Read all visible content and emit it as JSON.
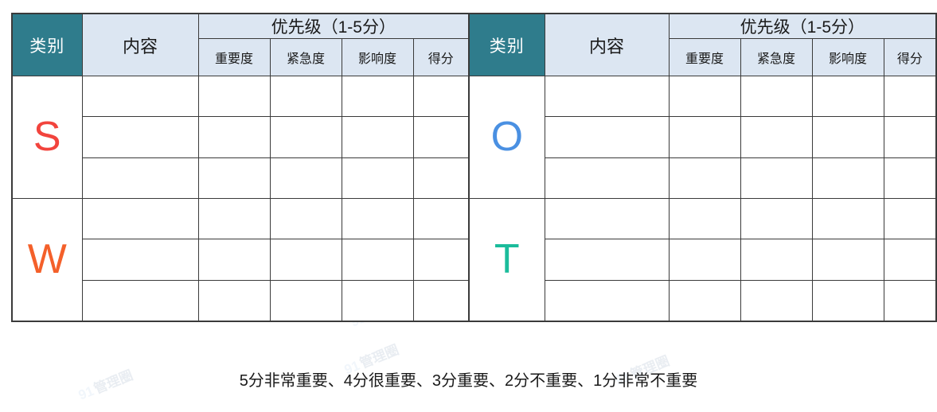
{
  "table": {
    "headers": {
      "category": "类别",
      "content": "内容",
      "priority": "优先级（1-5分）",
      "sub": {
        "importance": "重要度",
        "urgency": "紧急度",
        "impact": "影响度",
        "score": "得分"
      }
    },
    "left_block": {
      "groups": [
        {
          "letter": "S",
          "color": "#f2443d",
          "rows": 3
        },
        {
          "letter": "W",
          "color": "#f4602a",
          "rows": 3
        }
      ]
    },
    "right_block": {
      "groups": [
        {
          "letter": "O",
          "color": "#4a90e2",
          "rows": 3
        },
        {
          "letter": "T",
          "color": "#1bbc9b",
          "rows": 3
        }
      ]
    }
  },
  "footer": {
    "note": "5分非常重要、4分很重要、3分重要、2分不重要、1分非常不重要"
  },
  "watermark": {
    "mark": "91",
    "text": "管理圈"
  },
  "colors": {
    "header_teal": "#2f7c8c",
    "header_light_blue": "#dce6f2",
    "border": "#3a3a3a",
    "cell_background": "#ffffff",
    "text": "#1a1a1a"
  }
}
